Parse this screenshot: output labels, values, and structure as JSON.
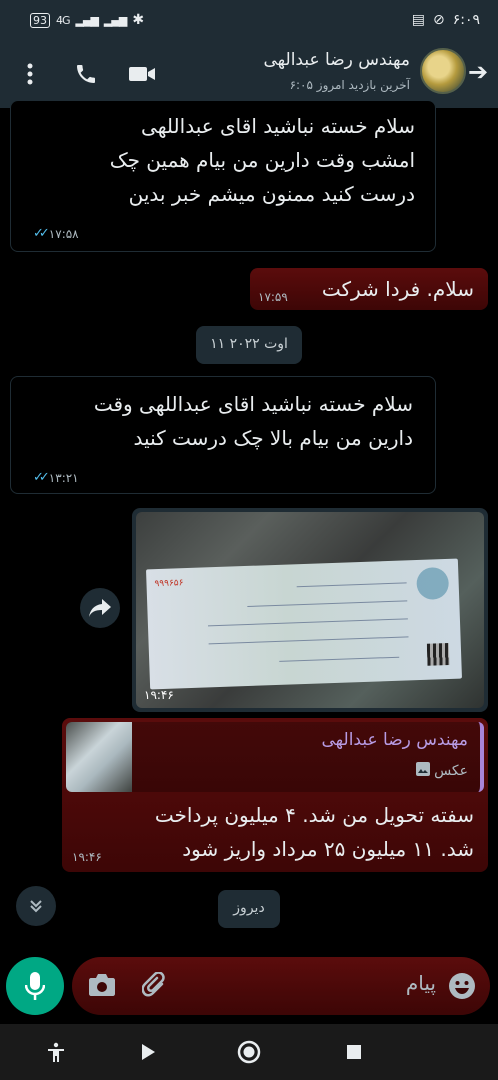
{
  "status_bar": {
    "time": "۶:۰۹",
    "battery": "93",
    "signal_1": "4G",
    "signal_2": "ill"
  },
  "header": {
    "contact_name": "مهندس رضا عبدالهی",
    "last_seen": "آخرین بازدید امروز ۶:۰۵"
  },
  "messages": [
    {
      "direction": "in",
      "lines": [
        "سلام خسته نباشید اقای عبداللهی",
        "امشب وقت دارین من بیام همین چک",
        "درست کنید ممنون میشم خبر بدین"
      ],
      "time": "۱۷:۵۸"
    },
    {
      "direction": "out",
      "text": "سلام. فردا شرکت",
      "time": "۱۷:۵۹"
    },
    {
      "direction": "in",
      "lines": [
        "سلام خسته نباشید اقای عبداللهی وقت",
        "دارین من بیام بالا چک درست کنید"
      ],
      "time": "۱۳:۲۱"
    },
    {
      "direction": "out",
      "type": "image",
      "time": "۱۹:۴۶",
      "cheque_number": "۹۹۹۶۵۶"
    },
    {
      "direction": "out",
      "quote": {
        "name": "مهندس رضا عبدالهی",
        "type": "عکس"
      },
      "lines": [
        "سفته تحویل من شد. ۴ میلیون پرداخت",
        "شد. ۱۱ میلیون ۲۵ مرداد واریز شود"
      ],
      "time": "۱۹:۴۶"
    }
  ],
  "date_chips": {
    "date_1": "۱۱ اوت ۲۰۲۲",
    "date_2": "دیروز"
  },
  "input": {
    "placeholder": "پیام"
  },
  "colors": {
    "bar": "#1f2c34",
    "outgoing": "#5b0c0c",
    "accent": "#00a884",
    "ticks": "#53bdeb"
  },
  "icons": [
    "back-arrow-icon",
    "menu-icon",
    "phone-icon",
    "video-icon",
    "forward-icon",
    "camera-icon",
    "attach-icon",
    "emoji-icon",
    "mic-icon",
    "chevrons-down-icon",
    "image-icon",
    "accessibility-icon",
    "back-triangle-icon",
    "home-circle-icon",
    "recents-square-icon"
  ]
}
